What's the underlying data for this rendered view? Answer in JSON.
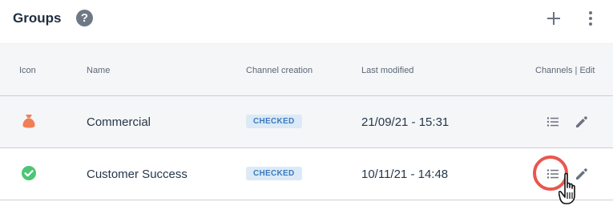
{
  "header": {
    "title": "Groups",
    "help_icon": "question-circle-icon",
    "help_glyph": "?",
    "add_icon": "plus-icon",
    "more_icon": "vertical-ellipsis-icon"
  },
  "table": {
    "columns": {
      "icon": "Icon",
      "name": "Name",
      "channel_creation": "Channel creation",
      "last_modified": "Last modified",
      "actions": "Channels | Edit"
    },
    "rows": [
      {
        "icon": "money-bag-icon",
        "name": "Commercial",
        "channel_creation": "CHECKED",
        "last_modified": "21/09/21 - 15:31"
      },
      {
        "icon": "check-circle-icon",
        "name": "Customer Success",
        "channel_creation": "CHECKED",
        "last_modified": "10/11/21 - 14:48"
      }
    ]
  },
  "colors": {
    "commercial_icon": "#f07f55",
    "success_icon": "#4cc675",
    "badge_bg": "#dbeaf6",
    "badge_text": "#3a7bbf",
    "click_highlight": "#e8574f"
  }
}
